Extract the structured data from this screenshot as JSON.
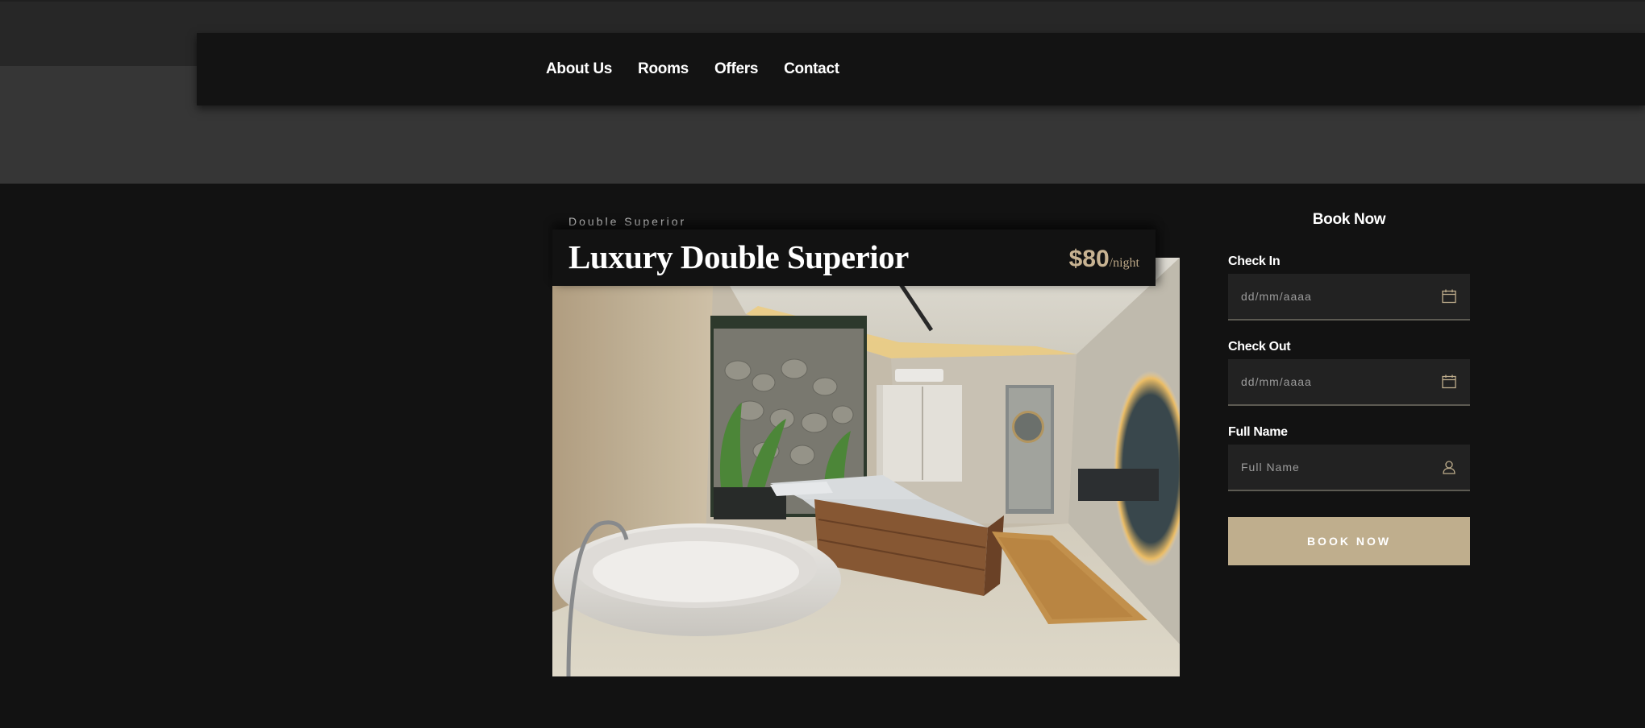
{
  "nav": {
    "items": [
      {
        "label": "About Us"
      },
      {
        "label": "Rooms"
      },
      {
        "label": "Offers"
      },
      {
        "label": "Contact"
      }
    ]
  },
  "room": {
    "category": "Double Superior",
    "title": "Luxury Double Superior",
    "price": "$80",
    "price_unit": "/night"
  },
  "booking": {
    "title": "Book Now",
    "fields": [
      {
        "label": "Check In",
        "placeholder": "dd/mm/aaaa",
        "icon": "calendar-icon"
      },
      {
        "label": "Check Out",
        "placeholder": "dd/mm/aaaa",
        "icon": "calendar-icon"
      },
      {
        "label": "Full Name",
        "placeholder": "Full Name",
        "icon": "user-icon"
      }
    ],
    "button_label": "BOOK NOW"
  },
  "colors": {
    "accent": "#bfae8d",
    "price": "#c8b392",
    "background": "#121212",
    "navbar": "#131313",
    "hero_band": "#363636",
    "field_bg": "#222222"
  }
}
